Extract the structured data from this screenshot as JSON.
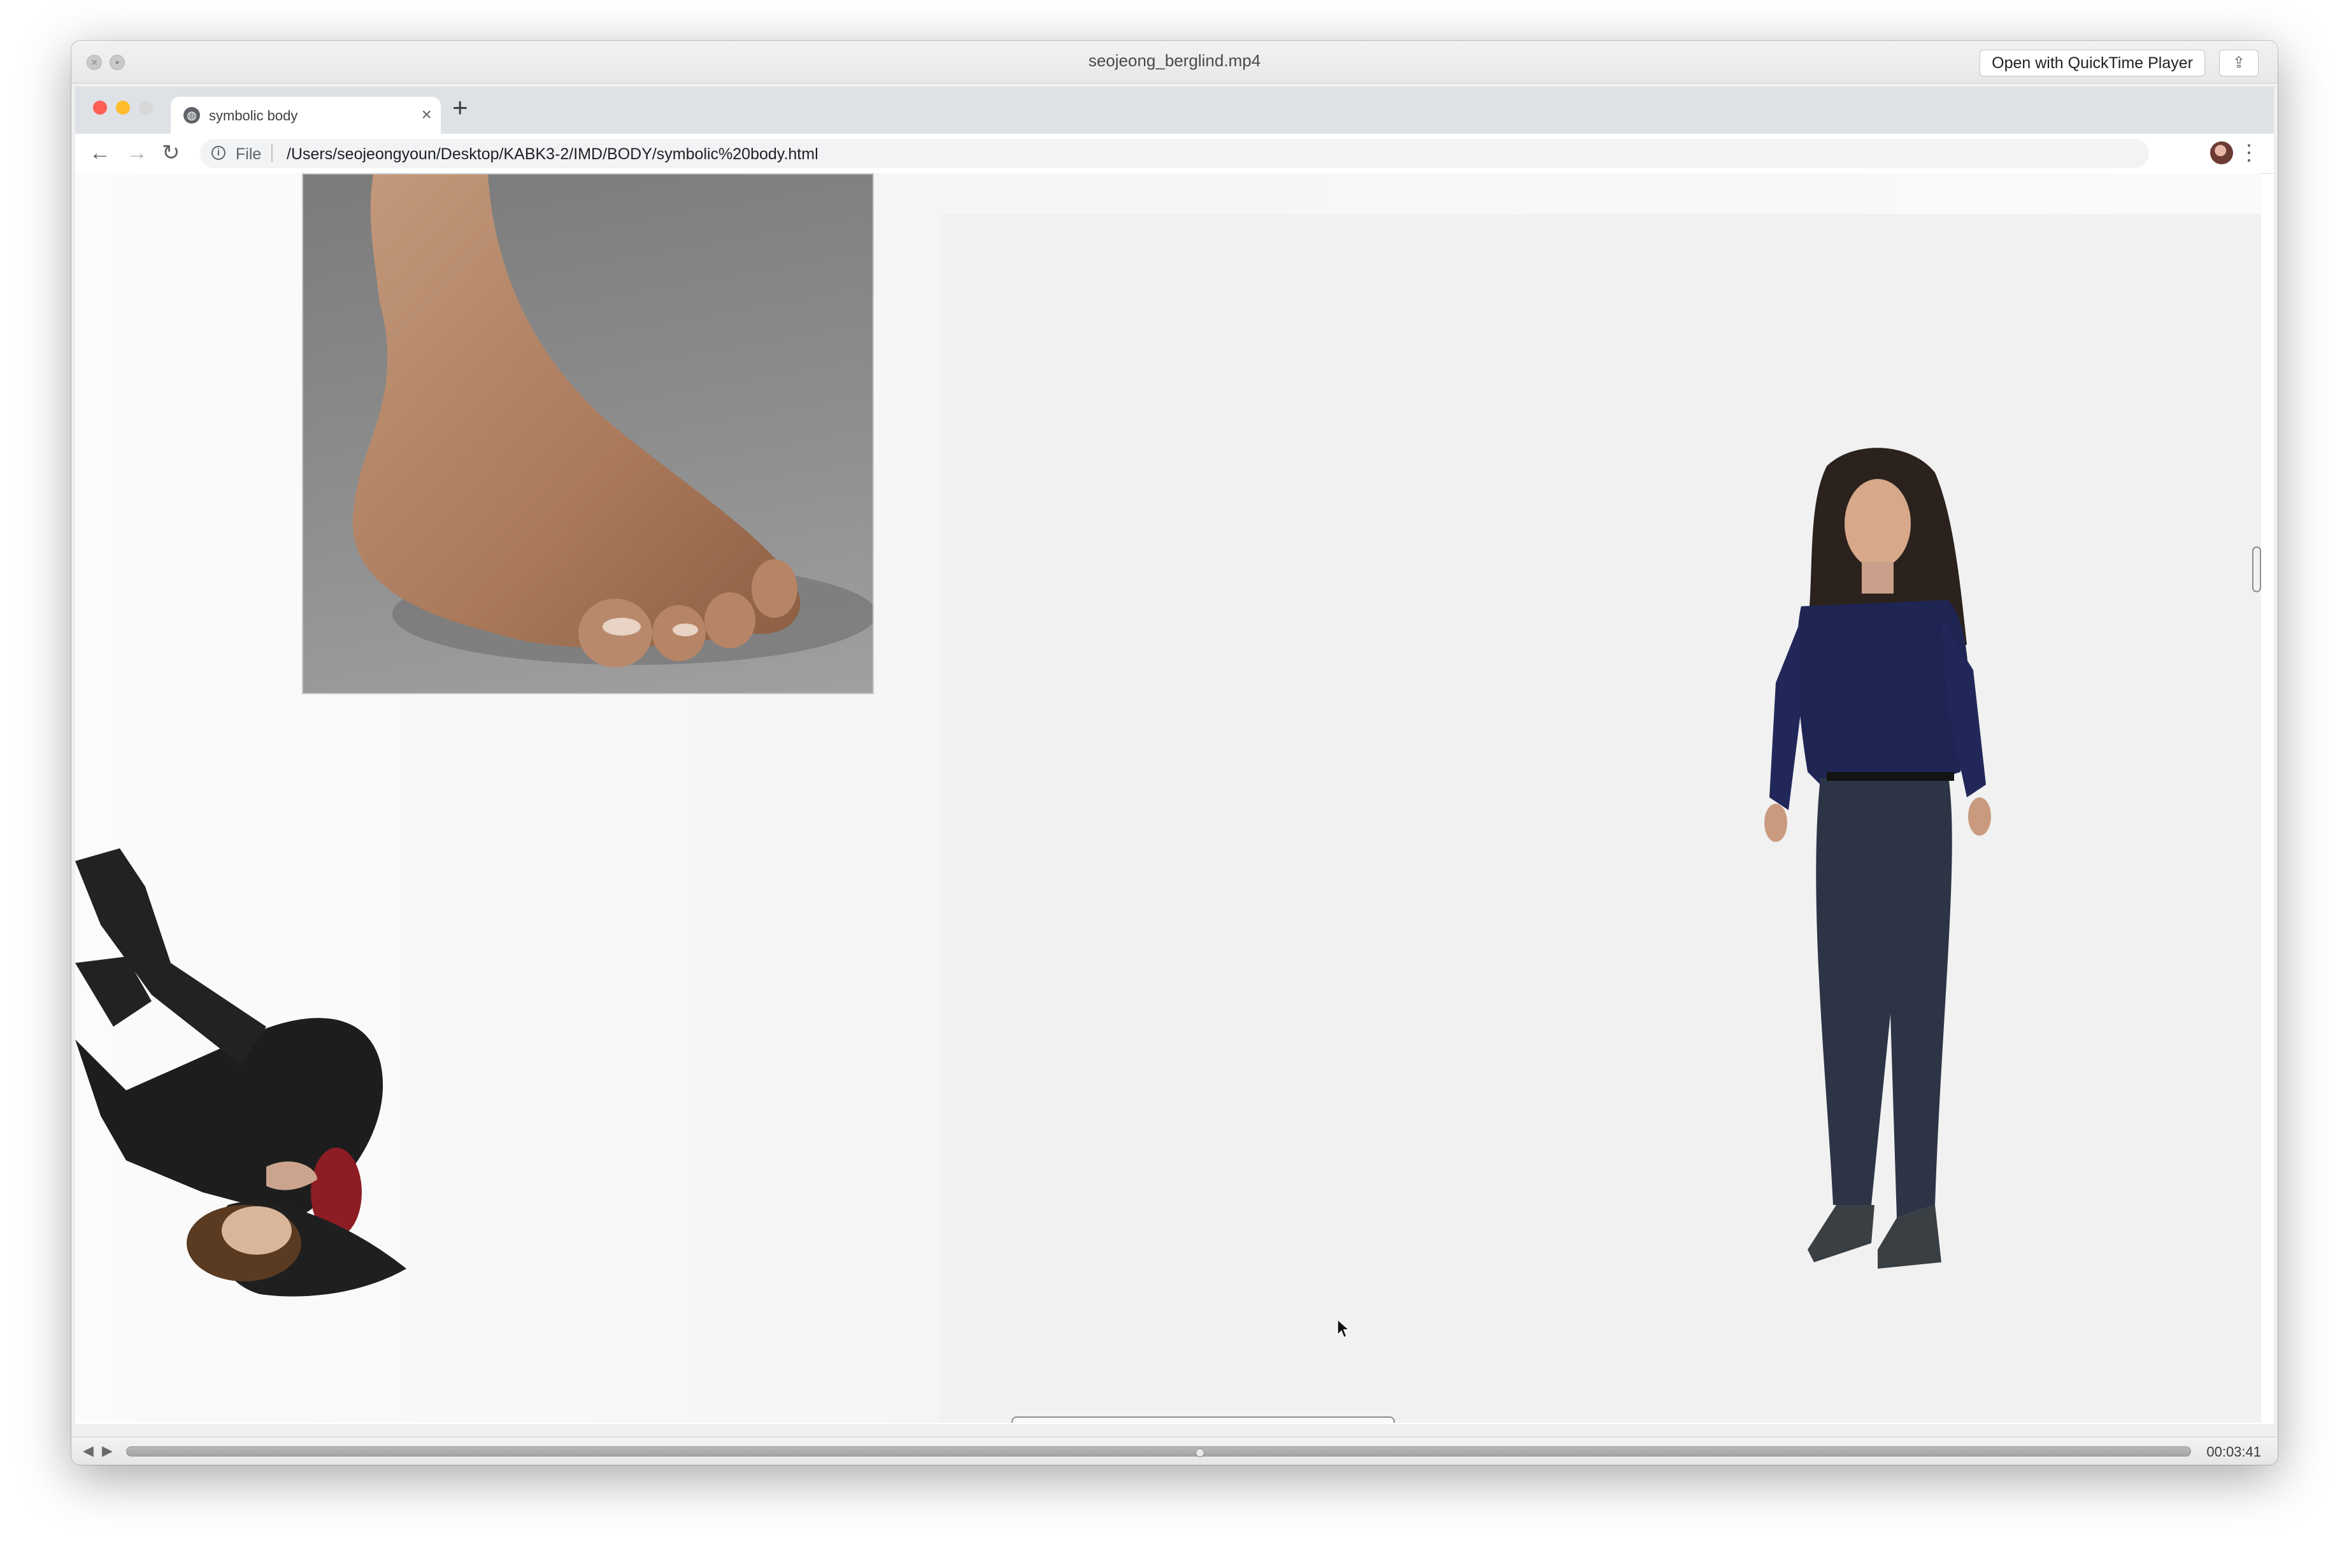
{
  "player": {
    "title": "seojeong_berglind.mp4",
    "open_button": "Open with QuickTime Player",
    "time": "00:03:41",
    "progress_percent": 52
  },
  "browser": {
    "tab_title": "symbolic body",
    "scheme_label": "File",
    "url": "/Users/seojeongyoun/Desktop/KABK3-2/IMD/BODY/symbolic%20body.html"
  },
  "icons": {
    "close": "close-icon",
    "fullscreen": "fullscreen-icon",
    "share": "share-icon",
    "back": "back-arrow-icon",
    "forward": "forward-arrow-icon",
    "reload": "reload-icon",
    "info": "info-icon",
    "star": "star-icon",
    "menu": "kebab-menu-icon",
    "favicon": "globe-icon",
    "play": "play-icon",
    "rewind": "rewind-icon"
  }
}
